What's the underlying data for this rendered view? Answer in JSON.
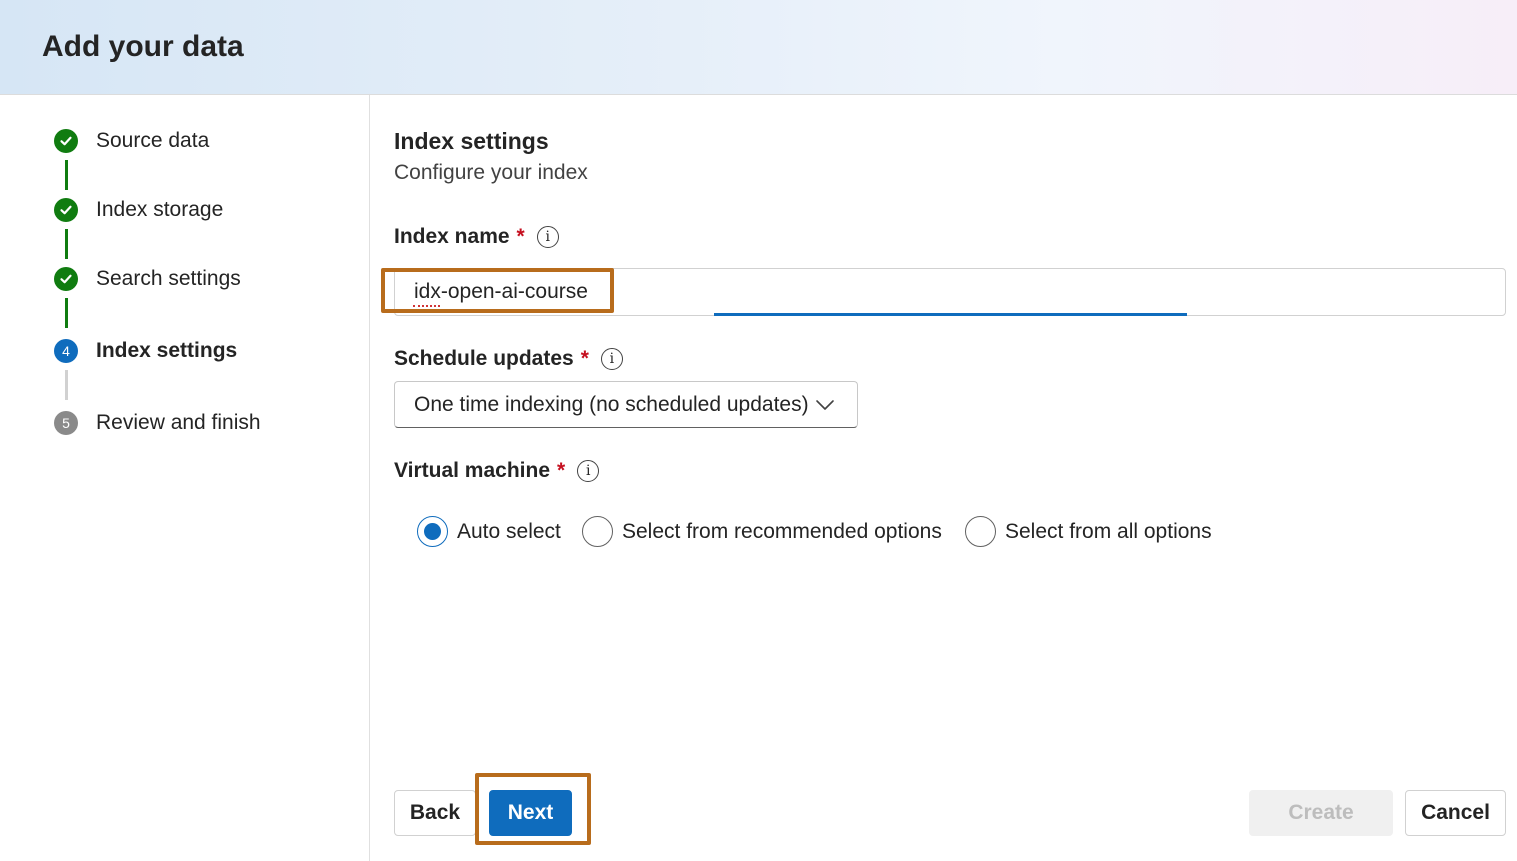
{
  "header": {
    "title": "Add your data"
  },
  "steps": [
    {
      "label": "Source data",
      "state": "done"
    },
    {
      "label": "Index storage",
      "state": "done"
    },
    {
      "label": "Search settings",
      "state": "done"
    },
    {
      "label": "Index settings",
      "state": "current",
      "number": "4"
    },
    {
      "label": "Review and finish",
      "state": "pending",
      "number": "5"
    }
  ],
  "section": {
    "title": "Index settings",
    "subtitle": "Configure your index"
  },
  "index_name": {
    "label": "Index name",
    "required_mark": "*",
    "value": "idx-open-ai-course"
  },
  "schedule": {
    "label": "Schedule updates",
    "required_mark": "*",
    "selected": "One time indexing (no scheduled updates)"
  },
  "vm": {
    "label": "Virtual machine",
    "required_mark": "*",
    "options": [
      {
        "label": "Auto select",
        "checked": true
      },
      {
        "label": "Select from recommended options",
        "checked": false
      },
      {
        "label": "Select from all options",
        "checked": false
      }
    ]
  },
  "buttons": {
    "back": "Back",
    "next": "Next",
    "create": "Create",
    "cancel": "Cancel"
  },
  "info_icon_glyph": "i",
  "colors": {
    "accent": "#0f6cbd",
    "success": "#107c10",
    "required": "#c50f1f",
    "highlight": "#b86c1c"
  }
}
